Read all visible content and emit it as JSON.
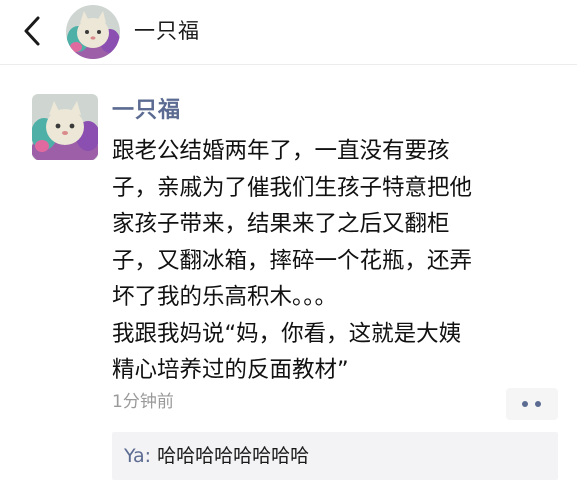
{
  "header": {
    "title": "一只福",
    "back_icon": "chevron-left-icon",
    "avatar_icon": "cat-avatar"
  },
  "post": {
    "author": "一只福",
    "avatar_icon": "cat-avatar",
    "lines": [
      "跟老公结婚两年了，一直没有要孩",
      "子，亲戚为了催我们生孩子特意把他",
      "家孩子带来，结果来了之后又翻柜",
      "子，又翻冰箱，摔碎一个花瓶，还弄",
      "坏了我的乐高积木。。。",
      "我跟我妈说“妈，你看，这就是大姨",
      "精心培养过的反面教材”"
    ],
    "time": "1分钟前",
    "more_icon": "more-dots-icon"
  },
  "comments": [
    {
      "user": "Ya",
      "separator": ": ",
      "text": "哈哈哈哈哈哈哈哈"
    }
  ],
  "colors": {
    "name_link": "#5b6b91",
    "time_gray": "#9a9a9a",
    "comment_bg": "#f3f3f5"
  }
}
